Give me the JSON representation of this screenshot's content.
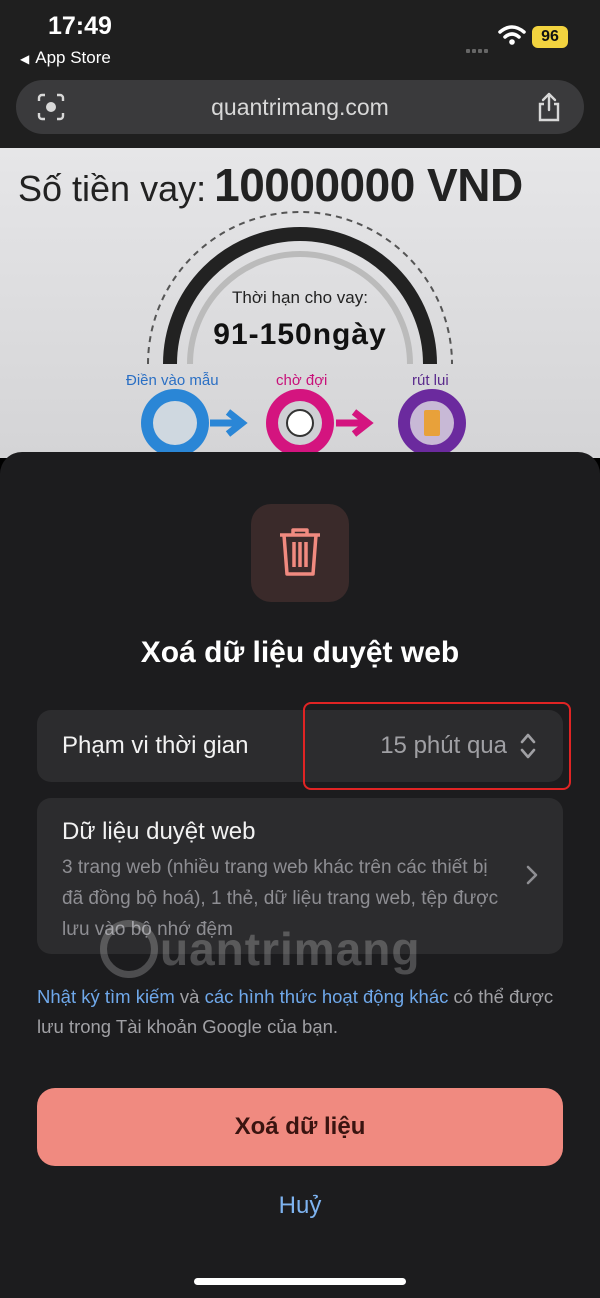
{
  "status_bar": {
    "time": "17:49",
    "back_label": "App Store",
    "battery": "96"
  },
  "browser": {
    "url": "quantrimang.com"
  },
  "webpage": {
    "loan_label": "Số tiền vay:",
    "loan_amount": "10000000 VND",
    "term_label": "Thời hạn cho vay:",
    "term_value": "91-150ngày",
    "steps": [
      "Điền vào mẫu",
      "chờ đợi",
      "rút lui"
    ]
  },
  "sheet": {
    "title": "Xoá dữ liệu duyệt web",
    "time_range_label": "Phạm vi thời gian",
    "time_range_value": "15 phút qua",
    "data_label": "Dữ liệu duyệt web",
    "data_desc": "3 trang web (nhiều trang web khác trên các thiết bị đã đồng bộ hoá), 1 thẻ, dữ liệu trang web, tệp được lưu vào bộ nhớ đệm",
    "note_link1": "Nhật ký tìm kiếm",
    "note_text1": " và ",
    "note_link2": "các hình thức hoạt động khác",
    "note_text2": " có thể được lưu trong Tài khoản Google của bạn.",
    "clear_button": "Xoá dữ liệu",
    "cancel_button": "Huỷ"
  },
  "watermark": "uantrimang",
  "colors": {
    "accent_red": "#f08a80",
    "link_blue": "#6fa8ea",
    "highlight_red": "#e02424"
  }
}
